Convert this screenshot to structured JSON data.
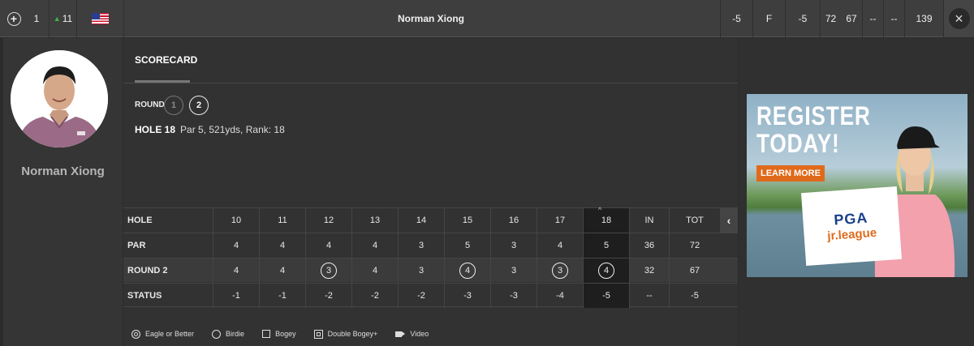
{
  "topbar": {
    "expand_symbol": "+",
    "position": "1",
    "movement": "11",
    "country": "USA",
    "player_name": "Norman Xiong",
    "stats": [
      "-5",
      "F",
      "-5",
      "72",
      "67",
      "--",
      "--",
      "139"
    ],
    "close_symbol": "×"
  },
  "profile": {
    "name": "Norman Xiong"
  },
  "scorecard": {
    "tab_label": "SCORECARD",
    "round_label": "ROUND",
    "rounds": [
      "1",
      "2"
    ],
    "selected_round": "2",
    "hole_label": "HOLE 18",
    "hole_details": "Par 5, 521yds, Rank: 18",
    "scroll_symbol": "‹",
    "current_marker": "^",
    "columns": [
      "10",
      "11",
      "12",
      "13",
      "14",
      "15",
      "16",
      "17",
      "18",
      "IN",
      "TOT"
    ],
    "row_labels": [
      "HOLE",
      "PAR",
      "ROUND 2",
      "STATUS"
    ],
    "par": [
      "4",
      "4",
      "4",
      "4",
      "3",
      "5",
      "3",
      "4",
      "5",
      "36",
      "72"
    ],
    "round2": [
      "4",
      "4",
      "3",
      "4",
      "3",
      "4",
      "3",
      "3",
      "4",
      "32",
      "67"
    ],
    "round2_birdie": [
      false,
      false,
      true,
      false,
      false,
      true,
      false,
      true,
      true,
      false,
      false
    ],
    "status": [
      "-1",
      "-1",
      "-2",
      "-2",
      "-2",
      "-3",
      "-3",
      "-4",
      "-5",
      "--",
      "-5"
    ],
    "current_hole_index": 8
  },
  "legend": [
    "Eagle or Better",
    "Birdie",
    "Bogey",
    "Double Bogey+",
    "Video"
  ],
  "ad": {
    "headline_1": "REGISTER",
    "headline_2": "TODAY!",
    "cta": "LEARN MORE",
    "brand_1": "PGA",
    "brand_2": "jr.league"
  },
  "colors": {
    "accent_green": "#3fb54a",
    "ad_orange": "#e06a1b",
    "pga_blue": "#1a3f8b"
  }
}
